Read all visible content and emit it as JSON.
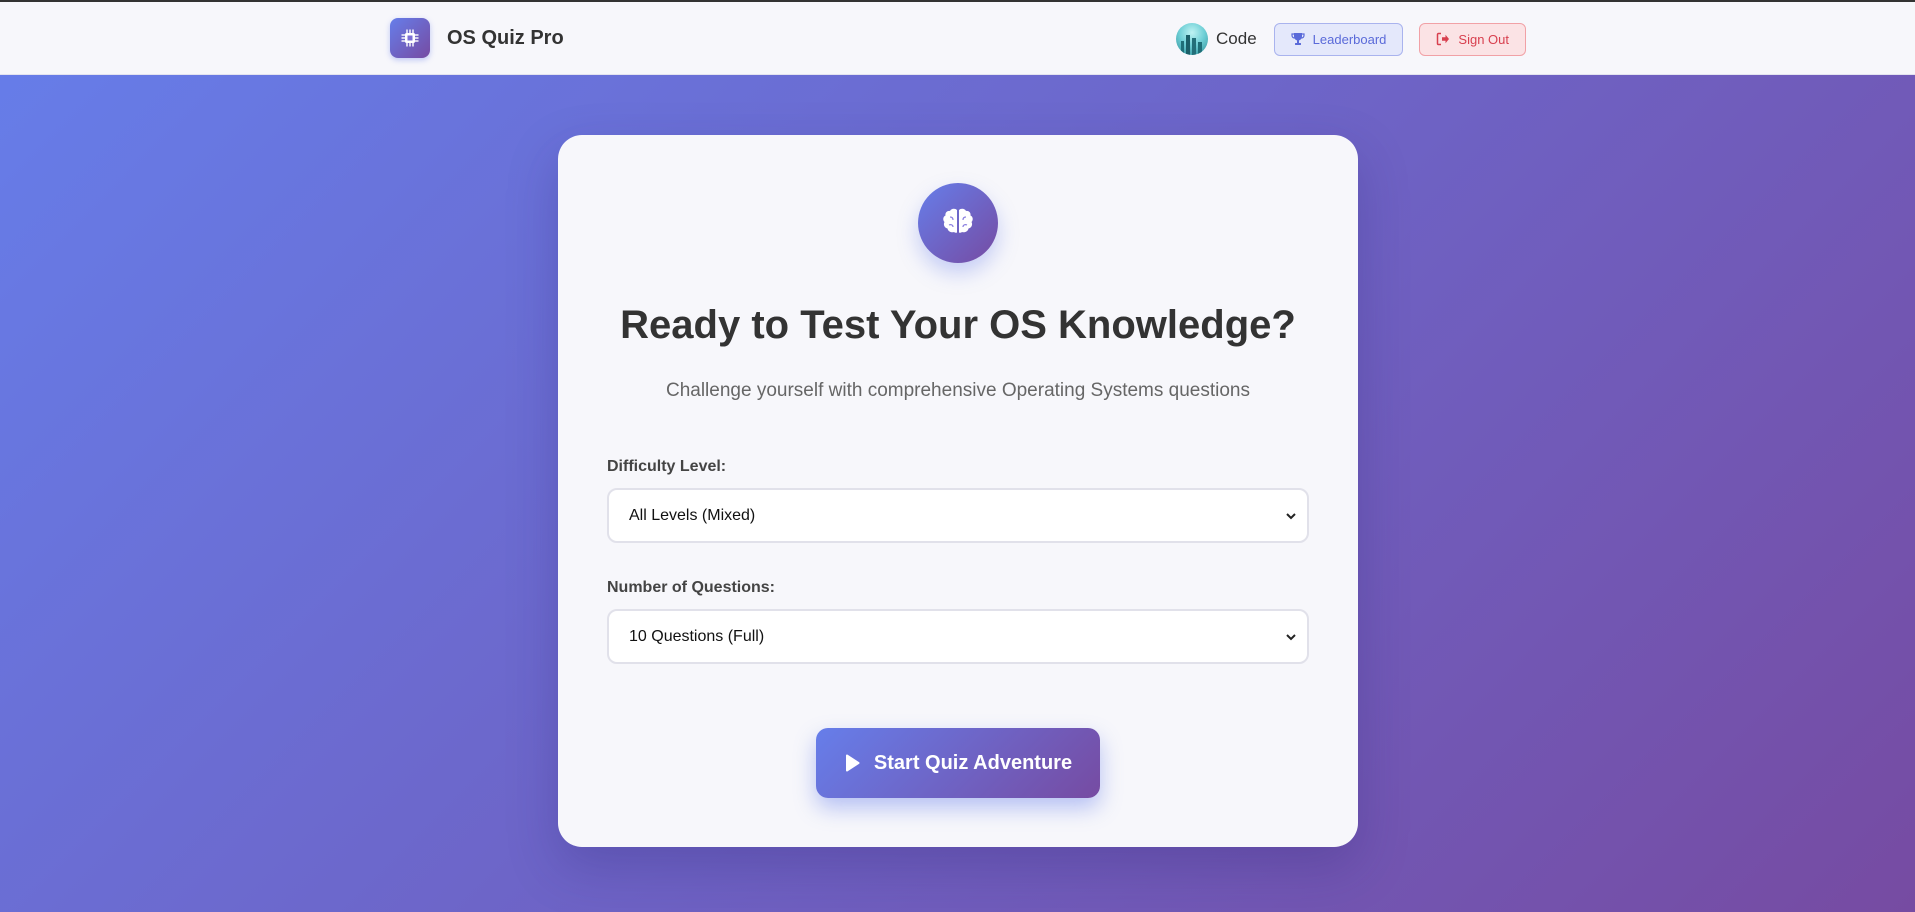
{
  "navbar": {
    "brand_title": "OS Quiz Pro",
    "brand_icon": "cpu-chip-icon",
    "username": "Code",
    "leaderboard_label": "Leaderboard",
    "signout_label": "Sign Out"
  },
  "hero": {
    "icon": "brain-icon",
    "title": "Ready to Test Your OS Knowledge?",
    "subtitle": "Challenge yourself with comprehensive Operating Systems questions"
  },
  "form": {
    "difficulty_label": "Difficulty Level:",
    "difficulty_value": "All Levels (Mixed)",
    "questions_label": "Number of Questions:",
    "questions_value": "10 Questions (Full)"
  },
  "start_button": {
    "label": "Start Quiz Adventure",
    "icon": "play-icon"
  },
  "colors": {
    "gradient_start": "#667eea",
    "gradient_end": "#764ba2",
    "danger": "#d8404f",
    "text": "#333333"
  }
}
